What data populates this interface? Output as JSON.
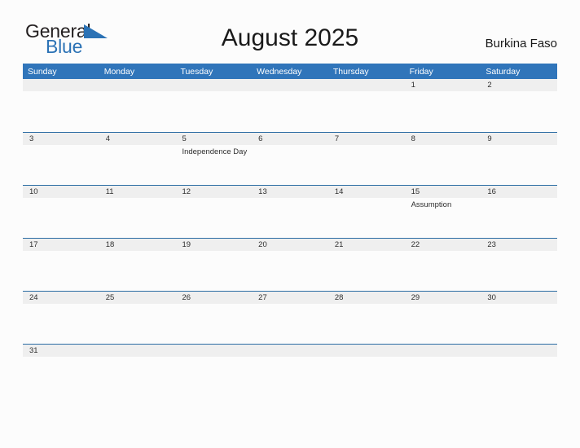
{
  "branding": {
    "logo_text_primary": "General",
    "logo_text_secondary": "Blue",
    "logo_primary_color": "#231f20",
    "logo_secondary_color": "#2b72b5",
    "flag_icon": "triangle-flag-icon"
  },
  "header": {
    "title": "August 2025",
    "country": "Burkina Faso"
  },
  "theme": {
    "header_bar_color": "#3075ba",
    "row_divider_color": "#2b6ca3",
    "date_band_color": "#efefef",
    "page_background": "#fcfcfc",
    "text_color": "#2e2e2e"
  },
  "calendar": {
    "weekdays": [
      "Sunday",
      "Monday",
      "Tuesday",
      "Wednesday",
      "Thursday",
      "Friday",
      "Saturday"
    ],
    "weeks": [
      {
        "days": [
          {
            "date": "",
            "event": ""
          },
          {
            "date": "",
            "event": ""
          },
          {
            "date": "",
            "event": ""
          },
          {
            "date": "",
            "event": ""
          },
          {
            "date": "",
            "event": ""
          },
          {
            "date": "1",
            "event": ""
          },
          {
            "date": "2",
            "event": ""
          }
        ]
      },
      {
        "days": [
          {
            "date": "3",
            "event": ""
          },
          {
            "date": "4",
            "event": ""
          },
          {
            "date": "5",
            "event": "Independence Day"
          },
          {
            "date": "6",
            "event": ""
          },
          {
            "date": "7",
            "event": ""
          },
          {
            "date": "8",
            "event": ""
          },
          {
            "date": "9",
            "event": ""
          }
        ]
      },
      {
        "days": [
          {
            "date": "10",
            "event": ""
          },
          {
            "date": "11",
            "event": ""
          },
          {
            "date": "12",
            "event": ""
          },
          {
            "date": "13",
            "event": ""
          },
          {
            "date": "14",
            "event": ""
          },
          {
            "date": "15",
            "event": "Assumption"
          },
          {
            "date": "16",
            "event": ""
          }
        ]
      },
      {
        "days": [
          {
            "date": "17",
            "event": ""
          },
          {
            "date": "18",
            "event": ""
          },
          {
            "date": "19",
            "event": ""
          },
          {
            "date": "20",
            "event": ""
          },
          {
            "date": "21",
            "event": ""
          },
          {
            "date": "22",
            "event": ""
          },
          {
            "date": "23",
            "event": ""
          }
        ]
      },
      {
        "days": [
          {
            "date": "24",
            "event": ""
          },
          {
            "date": "25",
            "event": ""
          },
          {
            "date": "26",
            "event": ""
          },
          {
            "date": "27",
            "event": ""
          },
          {
            "date": "28",
            "event": ""
          },
          {
            "date": "29",
            "event": ""
          },
          {
            "date": "30",
            "event": ""
          }
        ]
      },
      {
        "days": [
          {
            "date": "31",
            "event": ""
          },
          {
            "date": "",
            "event": ""
          },
          {
            "date": "",
            "event": ""
          },
          {
            "date": "",
            "event": ""
          },
          {
            "date": "",
            "event": ""
          },
          {
            "date": "",
            "event": ""
          },
          {
            "date": "",
            "event": ""
          }
        ]
      }
    ]
  }
}
